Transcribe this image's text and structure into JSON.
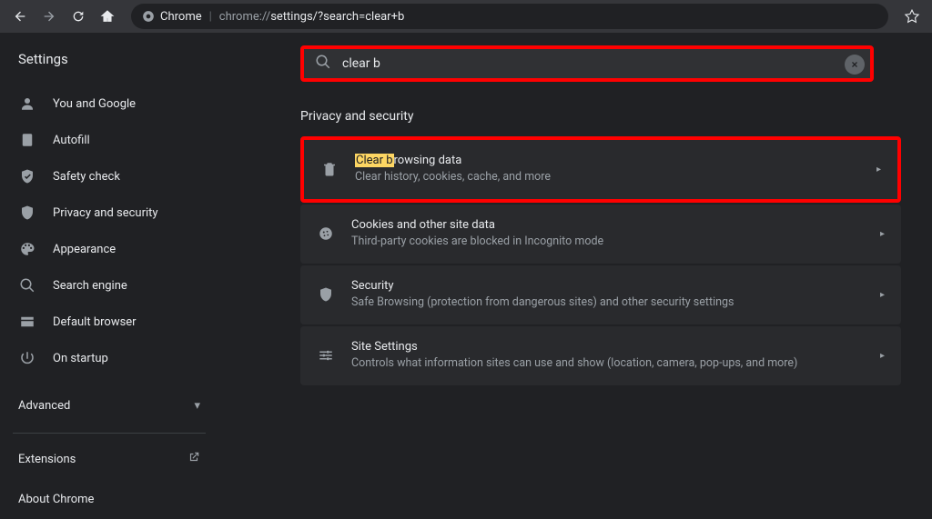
{
  "browser": {
    "url_prefix_label": "Chrome",
    "url_host": "chrome://",
    "url_path": "settings/?search=clear+b"
  },
  "page_title": "Settings",
  "sidebar": {
    "items": [
      {
        "label": "You and Google"
      },
      {
        "label": "Autofill"
      },
      {
        "label": "Safety check"
      },
      {
        "label": "Privacy and security"
      },
      {
        "label": "Appearance"
      },
      {
        "label": "Search engine"
      },
      {
        "label": "Default browser"
      },
      {
        "label": "On startup"
      }
    ],
    "advanced_label": "Advanced",
    "extensions_label": "Extensions",
    "about_label": "About Chrome"
  },
  "search": {
    "value": "clear b"
  },
  "section": {
    "title": "Privacy and security",
    "rows": [
      {
        "title_highlight": "Clear b",
        "title_rest": "rowsing data",
        "subtitle": "Clear history, cookies, cache, and more"
      },
      {
        "title": "Cookies and other site data",
        "subtitle": "Third-party cookies are blocked in Incognito mode"
      },
      {
        "title": "Security",
        "subtitle": "Safe Browsing (protection from dangerous sites) and other security settings"
      },
      {
        "title": "Site Settings",
        "subtitle": "Controls what information sites can use and show (location, camera, pop-ups, and more)"
      }
    ]
  }
}
